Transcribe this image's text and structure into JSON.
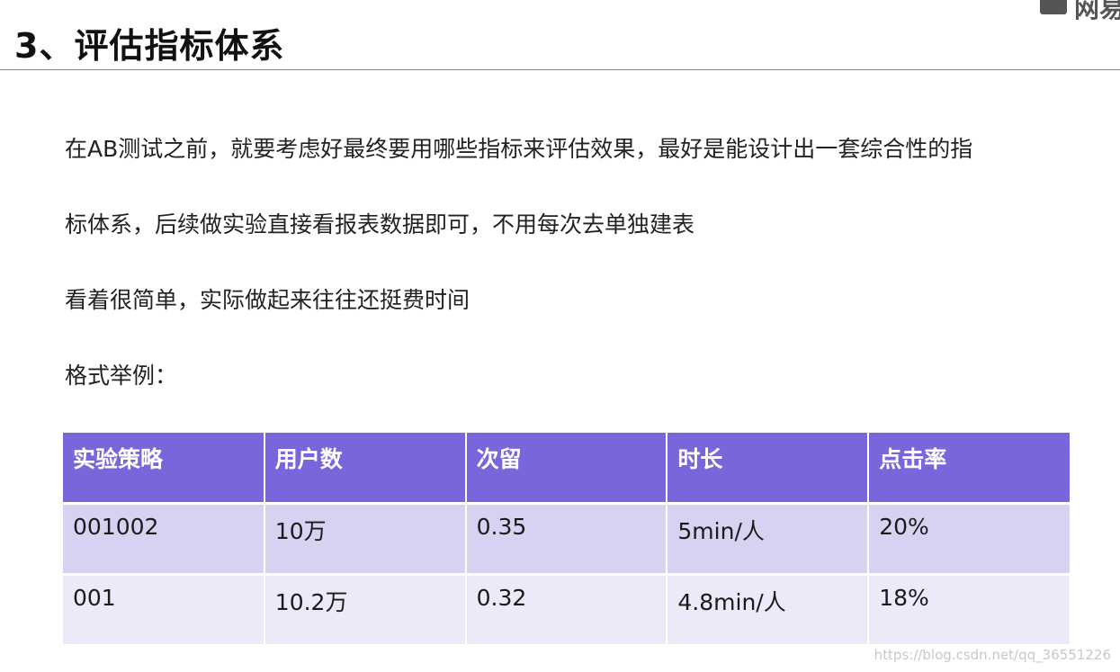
{
  "title": "3、评估指标体系",
  "header_logo_text": "网易",
  "paragraphs": [
    "在AB测试之前，就要考虑好最终要用哪些指标来评估效果，最好是能设计出一套综合性的指",
    "标体系，后续做实验直接看报表数据即可，不用每次去单独建表",
    "看着很简单，实际做起来往往还挺费时间",
    "格式举例："
  ],
  "table": {
    "headers": [
      "实验策略",
      "用户数",
      "次留",
      "时长",
      "点击率"
    ],
    "rows": [
      [
        "001002",
        "10万",
        "0.35",
        "5min/人",
        "20%"
      ],
      [
        "001",
        "10.2万",
        "0.32",
        "4.8min/人",
        "18%"
      ]
    ]
  },
  "watermark": "https://blog.csdn.net/qq_36551226",
  "colors": {
    "header_bg": "#7b65db",
    "row_odd_bg": "#d7d2f2",
    "row_even_bg": "#ece9f8"
  }
}
